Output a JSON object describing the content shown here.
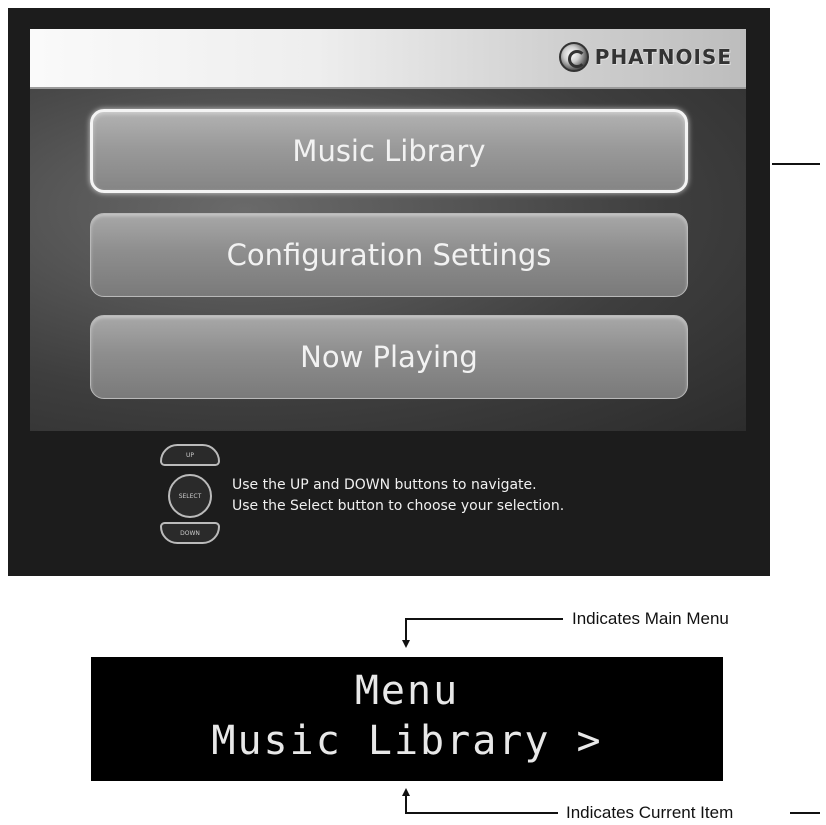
{
  "screen": {
    "brand": "PHATNOISE",
    "menu_items": [
      {
        "label": "Music Library",
        "selected": true
      },
      {
        "label": "Configuration Settings",
        "selected": false
      },
      {
        "label": "Now Playing",
        "selected": false
      }
    ],
    "remote": {
      "up_label": "UP",
      "select_label": "SELECT",
      "down_label": "DOWN"
    },
    "hint_lines": [
      "Use the UP and DOWN buttons to navigate.",
      "Use the Select button to choose your selection."
    ]
  },
  "callouts": {
    "top": "Indicates Main Menu",
    "bottom": "Indicates Current Item"
  },
  "lcd": {
    "line1": "Menu",
    "line2": "Music Library >"
  },
  "colors": {
    "screen_bg": "#1c1c1c",
    "button": "#8e8e8e",
    "button_selected_border": "#f4f4f4",
    "lcd_bg": "#000000",
    "lcd_text": "#e8e8e8"
  },
  "icons": {
    "logo": "phatnoise-logo-icon",
    "up": "up-arrow-button-icon",
    "select": "select-button-icon",
    "down": "down-arrow-button-icon"
  }
}
